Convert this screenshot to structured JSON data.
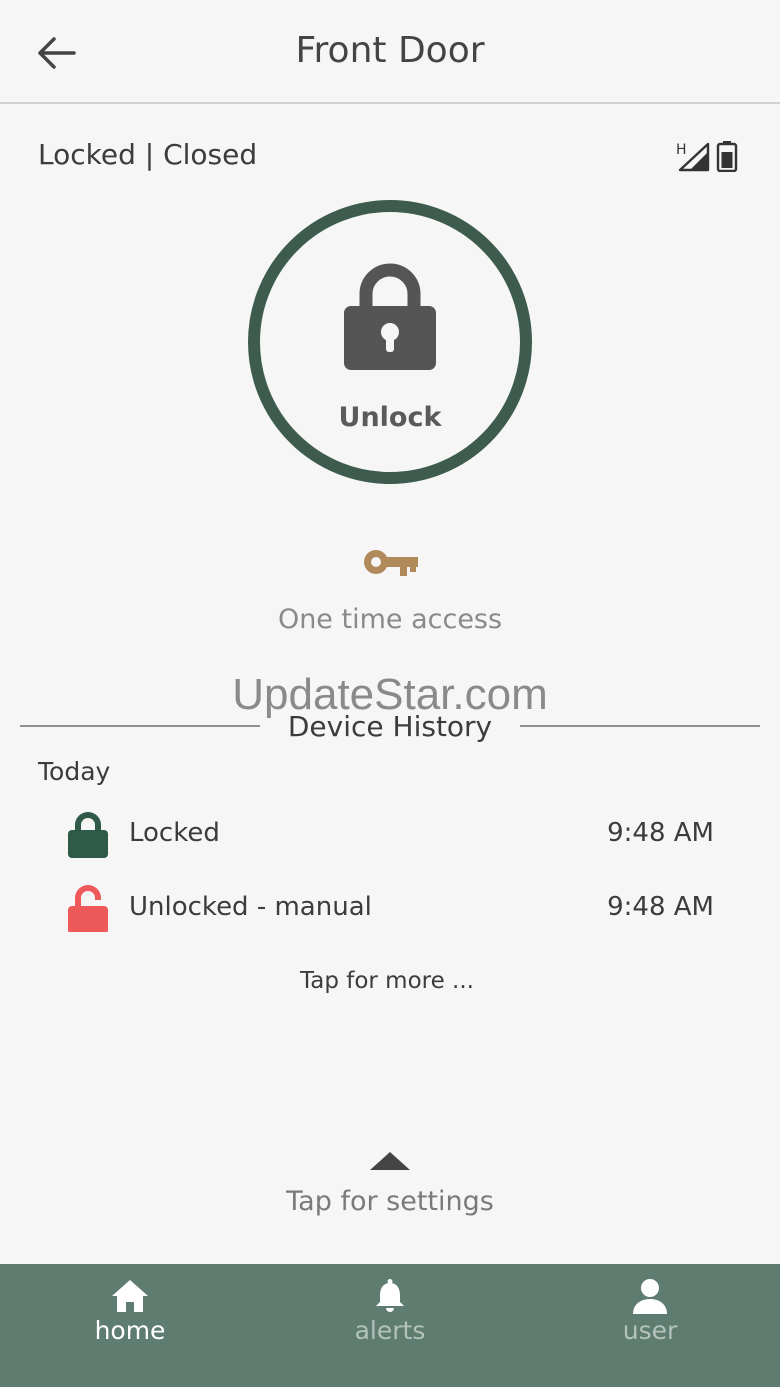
{
  "header": {
    "title": "Front Door",
    "back_icon": "arrow-left-icon"
  },
  "status": {
    "text": "Locked | Closed",
    "signal_label": "H",
    "signal_icon": "cell-signal-icon",
    "battery_icon": "battery-icon"
  },
  "lock_control": {
    "label": "Unlock",
    "icon": "padlock-icon",
    "ring_color": "#3d5c4e"
  },
  "access": {
    "label": "One time access",
    "icon": "key-icon",
    "icon_color": "#b08a5a"
  },
  "watermark": "UpdateStar.com",
  "history": {
    "title": "Device History",
    "day_label": "Today",
    "events": [
      {
        "label": "Locked",
        "time": "9:48 AM",
        "icon": "locked-icon",
        "color": "#2f5a48"
      },
      {
        "label": "Unlocked - manual",
        "time": "9:48 AM",
        "icon": "unlocked-icon",
        "color": "#ee5a5a"
      }
    ],
    "more_label": "Tap for more ..."
  },
  "settings": {
    "label": "Tap for settings",
    "icon": "chevron-up-icon"
  },
  "nav": {
    "active": "home",
    "items": [
      {
        "id": "home",
        "label": "home",
        "icon": "home-icon"
      },
      {
        "id": "alerts",
        "label": "alerts",
        "icon": "bell-icon"
      },
      {
        "id": "user",
        "label": "user",
        "icon": "user-icon"
      }
    ],
    "background": "#5e7c70"
  }
}
